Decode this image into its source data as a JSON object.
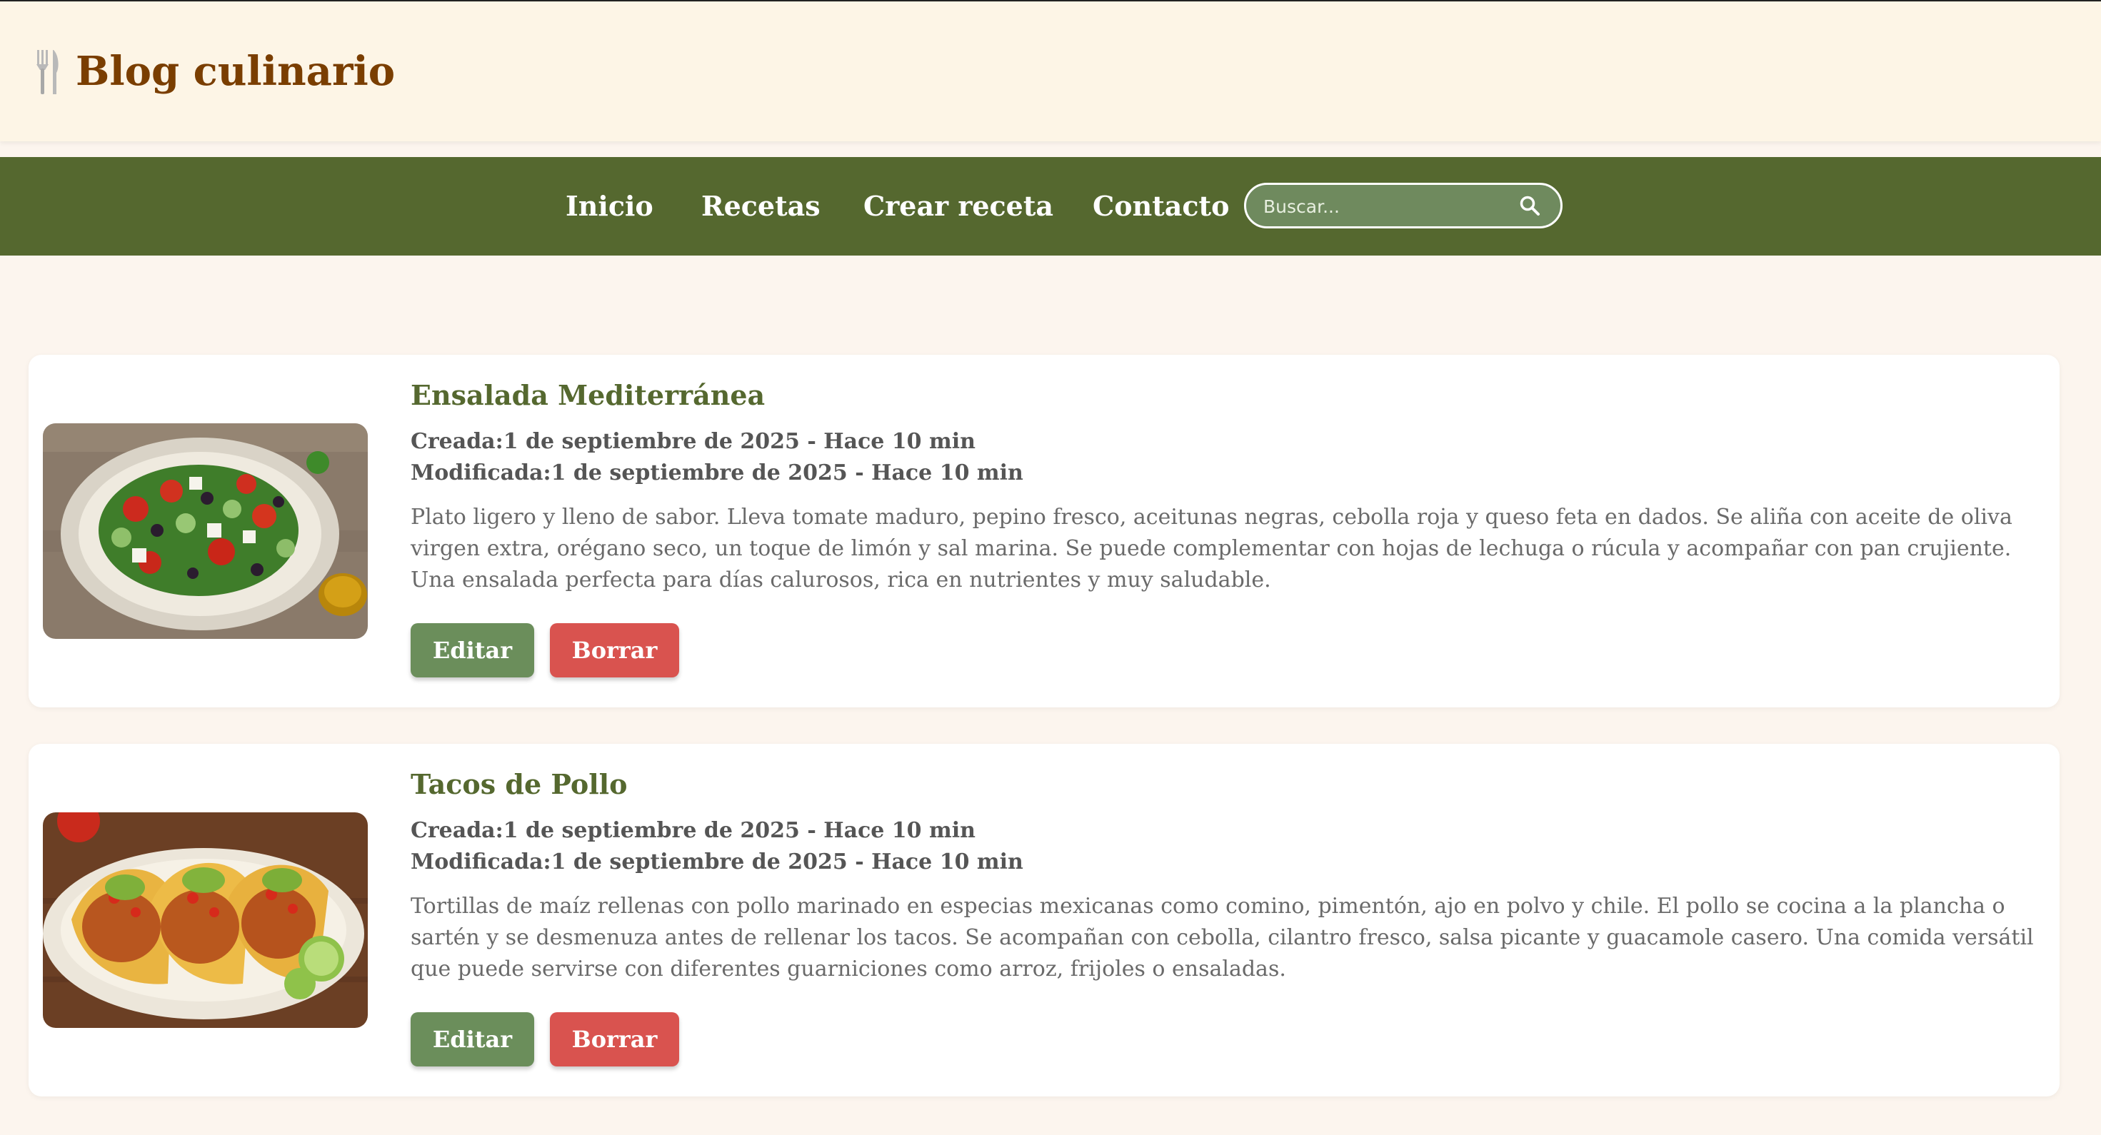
{
  "header": {
    "title": "Blog culinario",
    "logo_icon": "fork-knife-icon"
  },
  "nav": {
    "links": [
      "Inicio",
      "Recetas",
      "Crear receta",
      "Contacto"
    ],
    "search_placeholder": "Buscar..."
  },
  "colors": {
    "nav_bg": "#55682f",
    "title": "#7a3e00",
    "card_title": "#55682f",
    "edit_button": "#6b8e5b",
    "delete_button": "#d9534f"
  },
  "recipes": [
    {
      "title": "Ensalada Mediterránea",
      "created": "Creada:1 de septiembre de 2025 - Hace 10 min",
      "modified": "Modificada:1 de septiembre de 2025 - Hace 10 min",
      "description": "Plato ligero y lleno de sabor. Lleva tomate maduro, pepino fresco, aceitunas negras, cebolla roja y queso feta en dados. Se aliña con aceite de oliva virgen extra, orégano seco, un toque de limón y sal marina. Se puede complementar con hojas de lechuga o rúcula y acompañar con pan crujiente. Una ensalada perfecta para días calurosos, rica en nutrientes y muy saludable.",
      "edit_label": "Editar",
      "delete_label": "Borrar"
    },
    {
      "title": "Tacos de Pollo",
      "created": "Creada:1 de septiembre de 2025 - Hace 10 min",
      "modified": "Modificada:1 de septiembre de 2025 - Hace 10 min",
      "description": "Tortillas de maíz rellenas con pollo marinado en especias mexicanas como comino, pimentón, ajo en polvo y chile. El pollo se cocina a la plancha o sartén y se desmenuza antes de rellenar los tacos. Se acompañan con cebolla, cilantro fresco, salsa picante y guacamole casero. Una comida versátil que puede servirse con diferentes guarniciones como arroz, frijoles o ensaladas.",
      "edit_label": "Editar",
      "delete_label": "Borrar"
    }
  ]
}
